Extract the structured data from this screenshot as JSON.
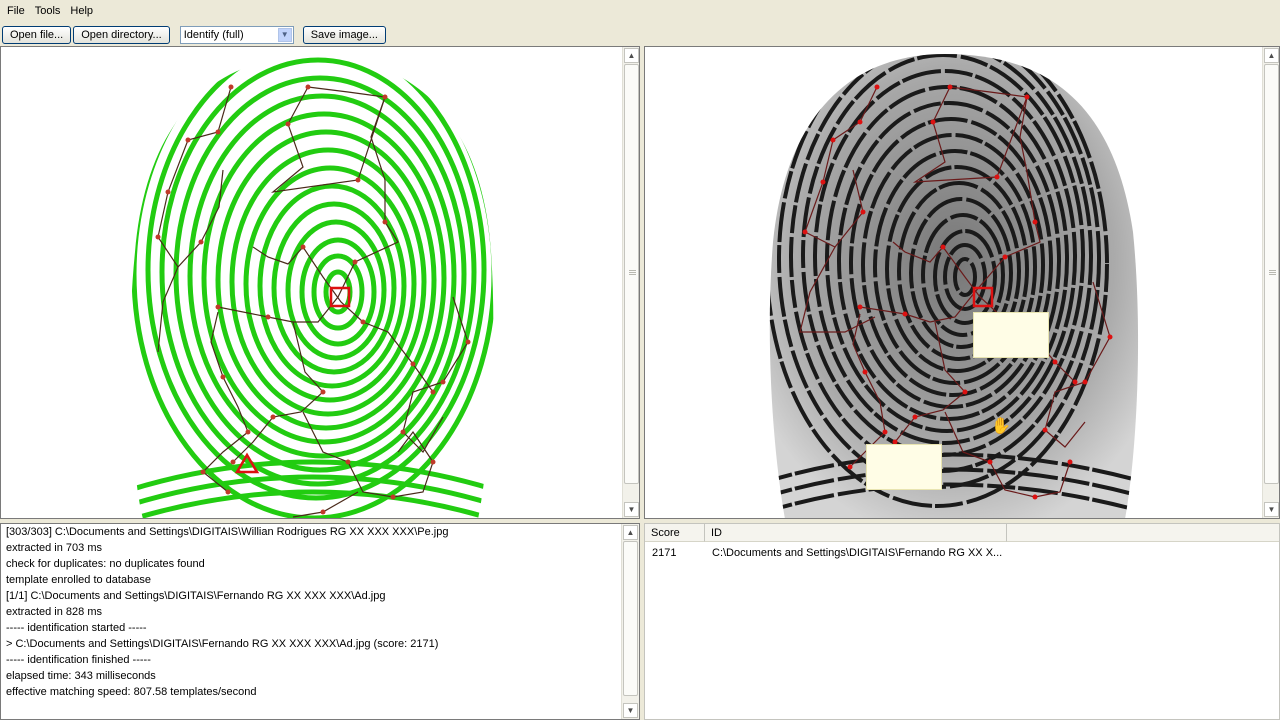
{
  "menu": {
    "file": "File",
    "tools": "Tools",
    "help": "Help"
  },
  "toolbar": {
    "open_file": "Open file...",
    "open_directory": "Open directory...",
    "mode_select": "Identify (full)",
    "save_image": "Save image..."
  },
  "log": {
    "lines": [
      "[303/303] C:\\Documents and Settings\\DIGITAIS\\Willian Rodrigues RG XX XXX XXX\\Pe.jpg",
      "extracted in 703 ms",
      "check for duplicates: no duplicates found",
      "template enrolled to database",
      "[1/1] C:\\Documents and Settings\\DIGITAIS\\Fernando RG XX XXX XXX\\Ad.jpg",
      "extracted in 828 ms",
      "----- identification started -----",
      "> C:\\Documents and Settings\\DIGITAIS\\Fernando RG XX XXX XXX\\Ad.jpg (score: 2171)",
      "----- identification finished -----",
      "elapsed time: 343 milliseconds",
      "effective matching speed:   807.58 templates/second"
    ]
  },
  "results": {
    "headers": {
      "score": "Score",
      "id": "ID"
    },
    "rows": [
      {
        "score": "2171",
        "id": "C:\\Documents and Settings\\DIGITAIS\\Fernando RG XX X..."
      }
    ]
  },
  "colors": {
    "ridge_green": "#22cc11",
    "minutia_red": "#dd1111",
    "link_dark": "#4a2a1a"
  }
}
